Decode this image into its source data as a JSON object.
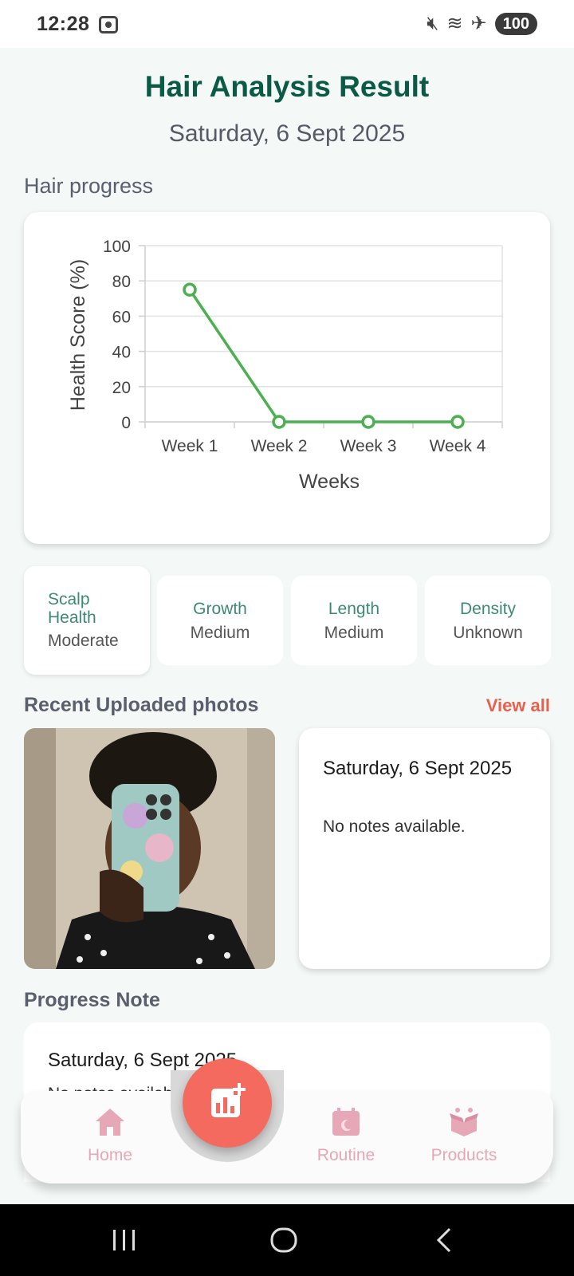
{
  "status_bar": {
    "time": "12:28",
    "battery": "100"
  },
  "header": {
    "title": "Hair Analysis Result",
    "date": "Saturday, 6 Sept 2025"
  },
  "hair_progress": {
    "label": "Hair progress"
  },
  "chart_data": {
    "type": "line",
    "categories": [
      "Week 1",
      "Week 2",
      "Week 3",
      "Week 4"
    ],
    "series": [
      {
        "values": [
          75,
          0,
          0,
          0
        ]
      }
    ],
    "xlabel": "Weeks",
    "ylabel": "Health Score (%)",
    "ylim": [
      0,
      100
    ],
    "yticks": [
      0,
      20,
      40,
      60,
      80,
      100
    ],
    "grid": true,
    "line_color": "#4caf50"
  },
  "metrics": [
    {
      "label": "Scalp Health",
      "value": "Moderate"
    },
    {
      "label": "Growth",
      "value": "Medium"
    },
    {
      "label": "Length",
      "value": "Medium"
    },
    {
      "label": "Density",
      "value": "Unknown"
    }
  ],
  "recent": {
    "label": "Recent Uploaded photos",
    "view_all": "View all"
  },
  "photo_note": {
    "date": "Saturday, 6 Sept 2025",
    "text": "No notes available."
  },
  "progress_note": {
    "label": "Progress Note",
    "date": "Saturday, 6 Sept 2025",
    "text": "No notes available."
  },
  "nav": {
    "home": "Home",
    "routine": "Routine",
    "products": "Products"
  },
  "colors": {
    "accent": "#0a5a45",
    "fab": "#f56a5f",
    "nav_icon": "#e6a7b6",
    "link": "#e8604c"
  }
}
